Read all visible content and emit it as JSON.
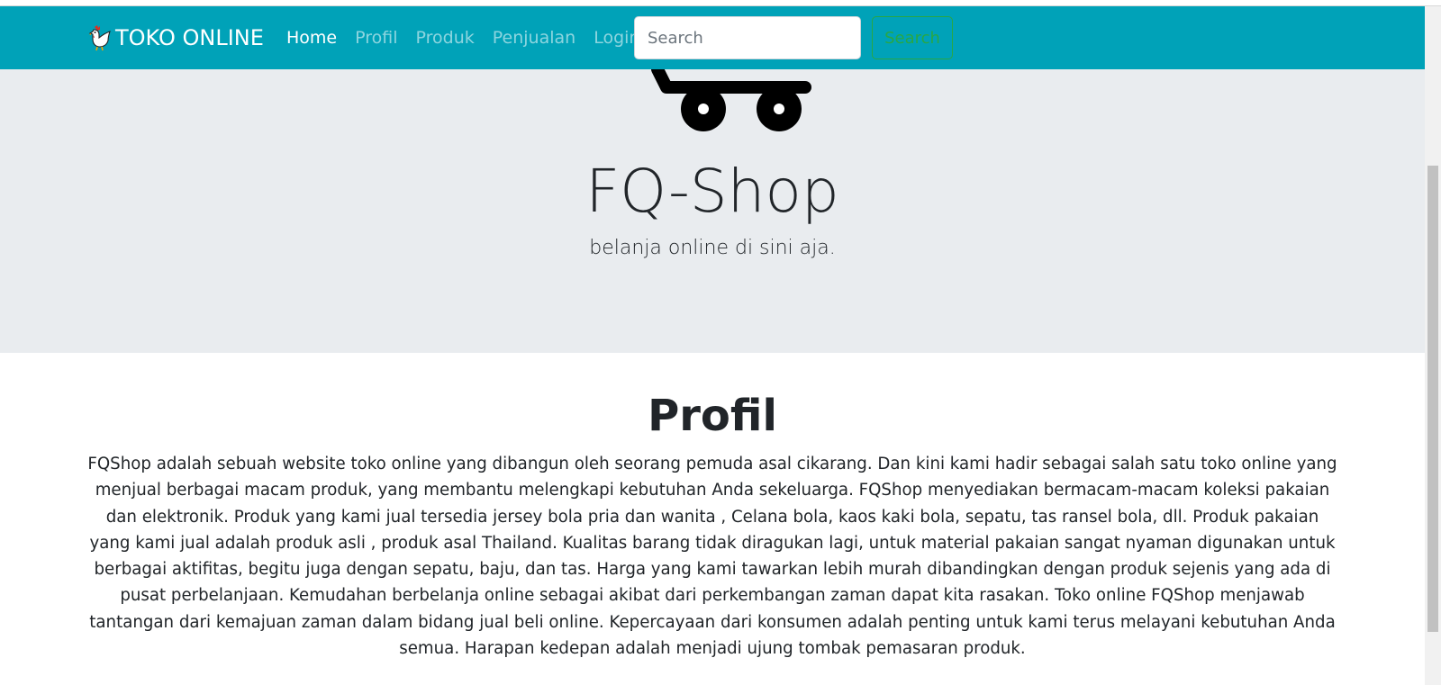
{
  "navbar": {
    "brand": "TOKO ONLINE",
    "brand_icon": "rooster-icon",
    "links": [
      {
        "label": "Home",
        "active": true
      },
      {
        "label": "Profil",
        "active": false
      },
      {
        "label": "Produk",
        "active": false
      },
      {
        "label": "Penjualan",
        "active": false
      },
      {
        "label": "Login",
        "active": false
      }
    ],
    "search_placeholder": "Search",
    "search_button": "Search",
    "bg_color": "#00a2b8"
  },
  "hero": {
    "icon": "shopping-cart-icon",
    "title": "FQ-Shop",
    "subtitle": "belanja online di sini aja."
  },
  "profil": {
    "title": "Profil",
    "text": "FQShop adalah sebuah website toko online yang dibangun oleh seorang pemuda asal cikarang. Dan kini kami hadir sebagai salah satu toko online yang menjual berbagai macam produk, yang membantu melengkapi kebutuhan Anda sekeluarga. FQShop menyediakan bermacam-macam koleksi pakaian dan elektronik. Produk yang kami jual tersedia jersey bola pria dan wanita , Celana bola, kaos kaki bola, sepatu, tas ransel bola, dll. Produk pakaian yang kami jual adalah produk asli , produk asal Thailand. Kualitas barang tidak diragukan lagi, untuk material pakaian sangat nyaman digunakan untuk berbagai aktifitas, begitu juga dengan sepatu, baju, dan tas. Harga yang kami tawarkan lebih murah dibandingkan dengan produk sejenis yang ada di pusat perbelanjaan. Kemudahan berbelanja online sebagai akibat dari perkembangan zaman dapat kita rasakan. Toko online FQShop menjawab tantangan dari kemajuan zaman dalam bidang jual beli online. Kepercayaan dari konsumen adalah penting untuk kami terus melayani kebutuhan Anda semua. Harapan kedepan adalah menjadi ujung tombak pemasaran produk."
  }
}
